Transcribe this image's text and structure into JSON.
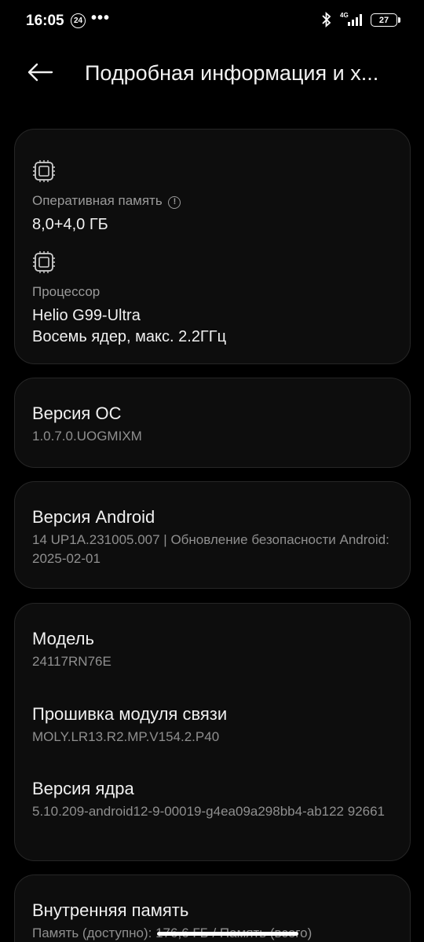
{
  "status_bar": {
    "time": "16:05",
    "notification_badge": "24",
    "more": "•••",
    "network": "4G",
    "battery": "27"
  },
  "header": {
    "title": "Подробная информация и х..."
  },
  "hardware": {
    "ram_label": "Оперативная память",
    "ram_value": "8,0+4,0 ГБ",
    "cpu_label": "Процессор",
    "cpu_value_1": "Helio G99-Ultra",
    "cpu_value_2": "Восемь ядер, макс. 2.2ГГц"
  },
  "os": {
    "title": "Версия ОС",
    "value": "1.0.7.0.UOGMIXM"
  },
  "android": {
    "title": "Версия Android",
    "value": "14 UP1A.231005.007 | Обновление безопасности Android: 2025-02-01"
  },
  "device": {
    "model_title": "Модель",
    "model_value": "24117RN76E",
    "baseband_title": "Прошивка модуля связи",
    "baseband_value": "MOLY.LR13.R2.MP.V154.2.P40",
    "kernel_title": "Версия ядра",
    "kernel_value": "5.10.209-android12-9-00019-g4ea09a298bb4-ab122 92661"
  },
  "storage": {
    "title": "Внутренняя память",
    "value": "Память (доступно): 176,6 ГБ / Память (всего)"
  },
  "icons": {
    "back": "arrow-left-icon",
    "chip": "chip-icon",
    "info": "info-circle-icon"
  }
}
